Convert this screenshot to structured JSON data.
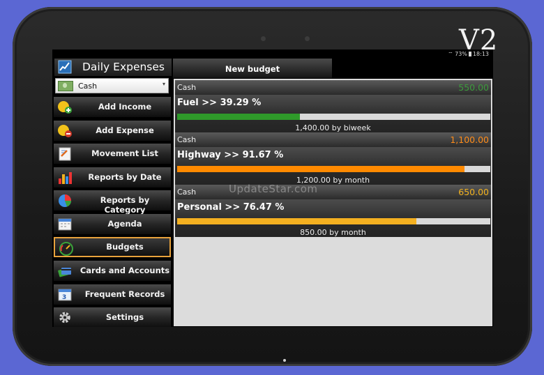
{
  "device": {
    "badge": "V2"
  },
  "statusbar": {
    "battery": "73%",
    "time": "18:13"
  },
  "app": {
    "title": "Daily Expenses"
  },
  "account_selector": {
    "value": "Cash"
  },
  "menu": [
    {
      "label": "Add Income",
      "icon": "add-income-icon",
      "selected": false
    },
    {
      "label": "Add Expense",
      "icon": "add-expense-icon",
      "selected": false
    },
    {
      "label": "Movement List",
      "icon": "notepad-icon",
      "selected": false
    },
    {
      "label": "Reports by Date",
      "icon": "bar-chart-icon",
      "selected": false
    },
    {
      "label": "Reports by Category",
      "icon": "pie-chart-icon",
      "selected": false
    },
    {
      "label": "Agenda",
      "icon": "calendar-icon",
      "selected": false
    },
    {
      "label": "Budgets",
      "icon": "gauge-icon",
      "selected": true
    },
    {
      "label": "Cards and Accounts",
      "icon": "cards-icon",
      "selected": false
    },
    {
      "label": "Frequent Records",
      "icon": "calendar-repeat-icon",
      "selected": false
    },
    {
      "label": "Settings",
      "icon": "gear-icon",
      "selected": false
    }
  ],
  "toolbar": {
    "new_budget_label": "New budget"
  },
  "budgets": [
    {
      "account": "Cash",
      "amount": "550.00",
      "amount_color": "#3c9a3c",
      "name": "Fuel >> 39.29 %",
      "percent": 39.29,
      "bar_color": "#2f9a2a",
      "subtitle": "1,400.00 by biweek"
    },
    {
      "account": "Cash",
      "amount": "1,100.00",
      "amount_color": "#ff8c1a",
      "name": "Highway >> 91.67 %",
      "percent": 91.67,
      "bar_color": "#ff8a00",
      "subtitle": "1,200.00 by month"
    },
    {
      "account": "Cash",
      "amount": "650.00",
      "amount_color": "#f2b21f",
      "name": "Personal >> 76.47 %",
      "percent": 76.47,
      "bar_color": "#f4b020",
      "subtitle": "850.00 by month"
    }
  ],
  "watermark": "UpdateStar.com"
}
